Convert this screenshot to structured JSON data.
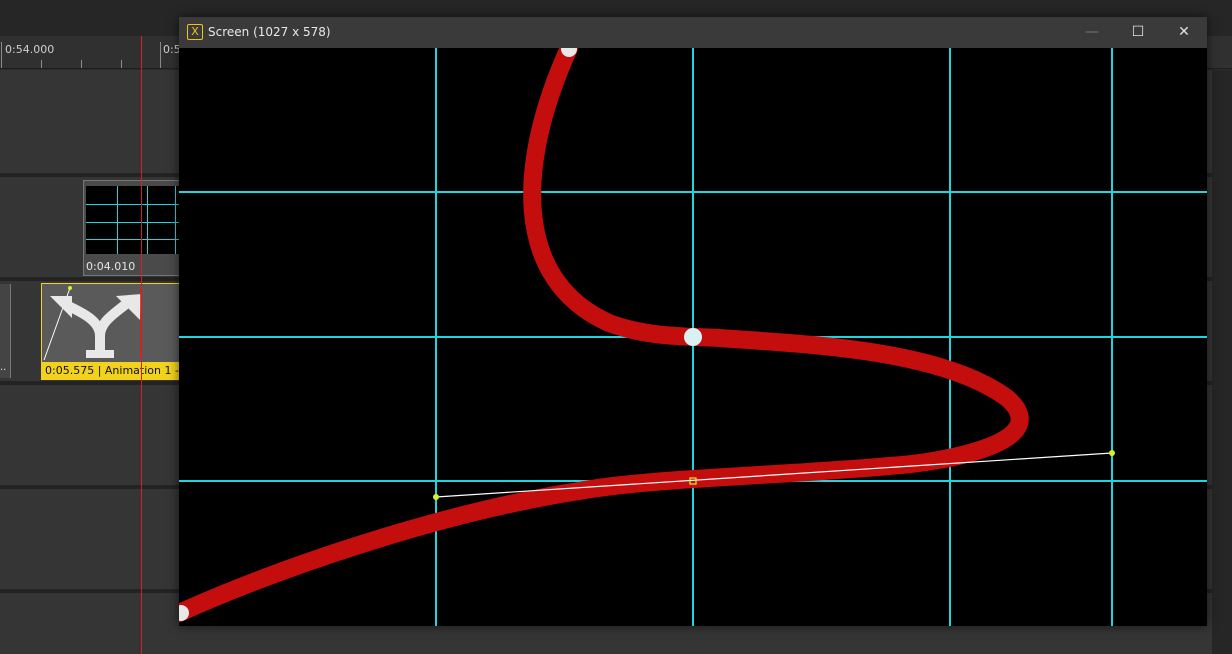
{
  "timeline": {
    "ruler_labels": [
      "0:54.000",
      "0:5"
    ],
    "clip_screen_label": "0:04.010",
    "clip_anim_label": "0:05.575 | Animation 1 -",
    "clip_small_label": ".."
  },
  "window": {
    "title": "Screen (1027 x 578)",
    "icon_glyph": "X",
    "minimize_glyph": "—",
    "maximize_glyph": "☐",
    "close_glyph": "✕"
  },
  "colors": {
    "guide": "#1fd6e0",
    "curve": "#c40d0d",
    "handle_line": "#ffffff",
    "handle_point": "#d8f02a",
    "anchor": "#e8e8e8",
    "anim_clip": "#f2d21c",
    "playhead": "#d42020"
  }
}
